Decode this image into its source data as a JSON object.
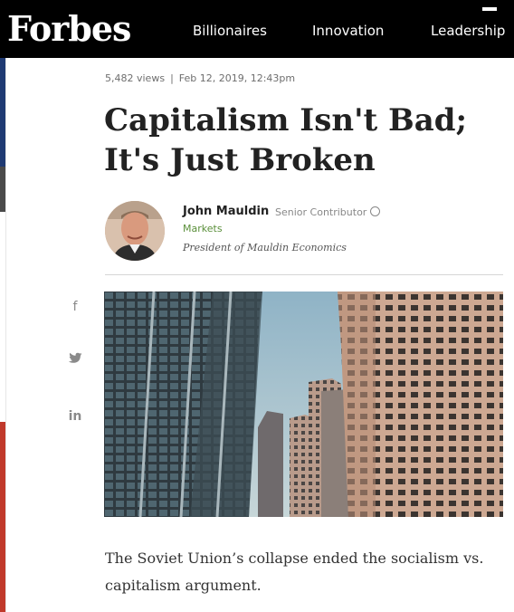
{
  "header": {
    "logo": "Forbes",
    "nav": [
      "Billionaires",
      "Innovation",
      "Leadership"
    ]
  },
  "article": {
    "views": "5,482 views",
    "date": "Feb 12, 2019, 12:43pm",
    "meta_separator": "|",
    "headline_line1": "Capitalism Isn't Bad;",
    "headline_line2": "It's Just Broken",
    "body": "The Soviet Union’s collapse ended the socialism vs. capitalism argument."
  },
  "author": {
    "name": "John Mauldin",
    "role": "Senior Contributor",
    "section": "Markets",
    "description": "President of Mauldin Economics"
  },
  "share": {
    "facebook": "f",
    "linkedin": "in"
  },
  "colors": {
    "header_bg": "#000000",
    "section_link": "#5a8f3a",
    "headline": "#222222"
  },
  "icons": [
    "facebook-icon",
    "twitter-icon",
    "linkedin-icon",
    "info-icon"
  ]
}
